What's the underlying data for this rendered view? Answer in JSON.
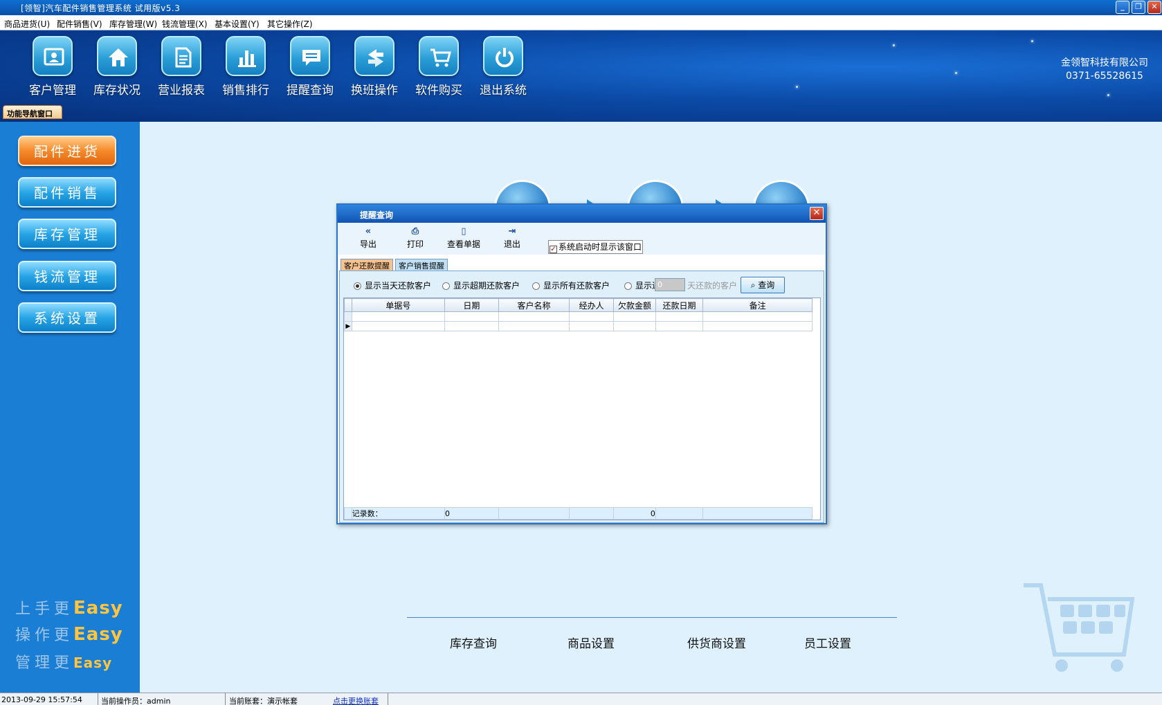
{
  "window": {
    "title": "[领智]汽车配件销售管理系统 试用版v5.3",
    "controls": [
      "_",
      "❐",
      "✕"
    ]
  },
  "menu": [
    "商品进货(U)",
    "配件销售(V)",
    "库存管理(W)",
    "钱流管理(X)",
    "基本设置(Y)",
    "其它操作(Z)"
  ],
  "toolbar": {
    "buttons": [
      {
        "label": "客户管理",
        "icon": "contact-card-icon"
      },
      {
        "label": "库存状况",
        "icon": "home-icon"
      },
      {
        "label": "营业报表",
        "icon": "document-icon"
      },
      {
        "label": "销售排行",
        "icon": "bar-chart-icon"
      },
      {
        "label": "提醒查询",
        "icon": "message-icon"
      },
      {
        "label": "换班操作",
        "icon": "swap-icon"
      },
      {
        "label": "软件购买",
        "icon": "cart-icon"
      },
      {
        "label": "退出系统",
        "icon": "power-icon"
      }
    ]
  },
  "company": {
    "name": "金领智科技有限公司",
    "phone": "0371-65528615"
  },
  "nav_window_tab": "功能导航窗口",
  "sidebar": {
    "items": [
      {
        "label": "配件进货",
        "active": true
      },
      {
        "label": "配件销售",
        "active": false
      },
      {
        "label": "库存管理",
        "active": false
      },
      {
        "label": "钱流管理",
        "active": false
      },
      {
        "label": "系统设置",
        "active": false
      }
    ],
    "slogans": [
      {
        "text": "上手更",
        "accent": "Easy"
      },
      {
        "text": "操作更",
        "accent": "Easy"
      },
      {
        "text": "管理更",
        "accent": "Easy"
      }
    ]
  },
  "main": {
    "bottom_links": [
      "库存查询",
      "商品设置",
      "供货商设置",
      "员工设置"
    ]
  },
  "dialog": {
    "title": "提醒查询",
    "tools": [
      {
        "label": "导出",
        "icon": "double-chevron-left-icon"
      },
      {
        "label": "打印",
        "icon": "printer-icon"
      },
      {
        "label": "查看单据",
        "icon": "document-search-icon"
      },
      {
        "label": "退出",
        "icon": "exit-door-icon"
      }
    ],
    "show_on_startup": {
      "label": "系统启动时显示该窗口",
      "checked": true
    },
    "tabs": [
      {
        "label": "客户还款提醒",
        "active": true
      },
      {
        "label": "客户销售提醒",
        "active": false
      }
    ],
    "filters": [
      {
        "label": "显示当天还款客户",
        "selected": true
      },
      {
        "label": "显示超期还款客户",
        "selected": false
      },
      {
        "label": "显示所有还款客户",
        "selected": false
      },
      {
        "label": "显示近",
        "selected": false
      }
    ],
    "days_value": "0",
    "days_suffix": "天还款的客户",
    "query_button": "查询",
    "columns": [
      "单据号",
      "日期",
      "客户名称",
      "经办人",
      "欠款金额",
      "还款日期",
      "备注"
    ],
    "footer": {
      "label": "记录数：",
      "count": "0",
      "amount": "0"
    }
  },
  "status": {
    "datetime": "2013-09-29 15:57:54",
    "operator": "当前操作员：admin",
    "account": "当前账套：演示帐套",
    "switch_link": "点击更换账套"
  }
}
